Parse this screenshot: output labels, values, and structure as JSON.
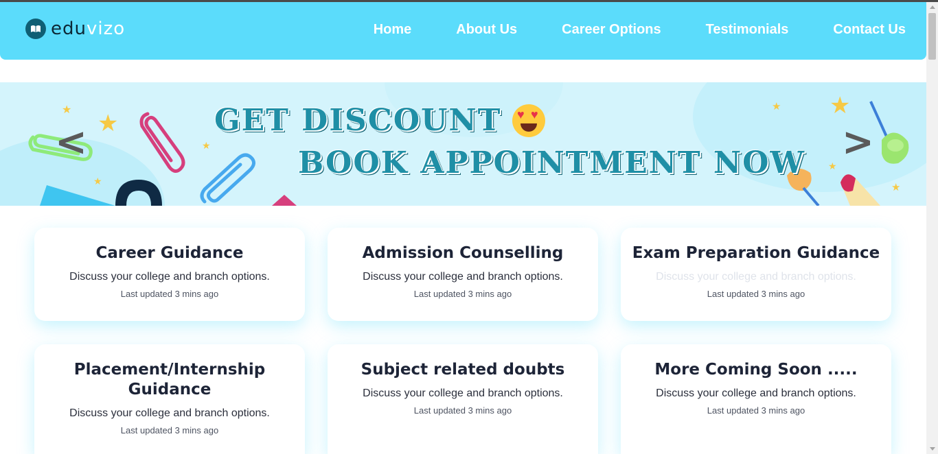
{
  "logo": {
    "text_a": "edu",
    "text_b": "vizo"
  },
  "nav": {
    "items": [
      "Home",
      "About Us",
      "Career Options",
      "Testimonials",
      "Contact Us"
    ]
  },
  "banner": {
    "line1": "GET DISCOUNT",
    "line2": "BOOK APPOINTMENT NOW",
    "prev": "<",
    "next": ">"
  },
  "cards": [
    {
      "title": "Career Guidance",
      "desc": "Discuss your college and branch options.",
      "meta": "Last updated 3 mins ago"
    },
    {
      "title": "Admission Counselling",
      "desc": "Discuss your college and branch options.",
      "meta": "Last updated 3 mins ago"
    },
    {
      "title": "Exam Preparation Guidance",
      "desc": "Discuss your college and branch options.",
      "meta": "Last updated 3 mins ago"
    },
    {
      "title": "Placement/Internship Guidance",
      "desc": "Discuss your college and branch options.",
      "meta": "Last updated 3 mins ago"
    },
    {
      "title": "Subject related doubts",
      "desc": "Discuss your college and branch options.",
      "meta": "Last updated 3 mins ago"
    },
    {
      "title": "More Coming Soon .....",
      "desc": "Discuss your college and branch options.",
      "meta": "Last updated 3 mins ago"
    }
  ],
  "colors": {
    "navbar": "#5bdcfb",
    "banner_text": "#1f8fa6",
    "card_title": "#1d2437"
  }
}
